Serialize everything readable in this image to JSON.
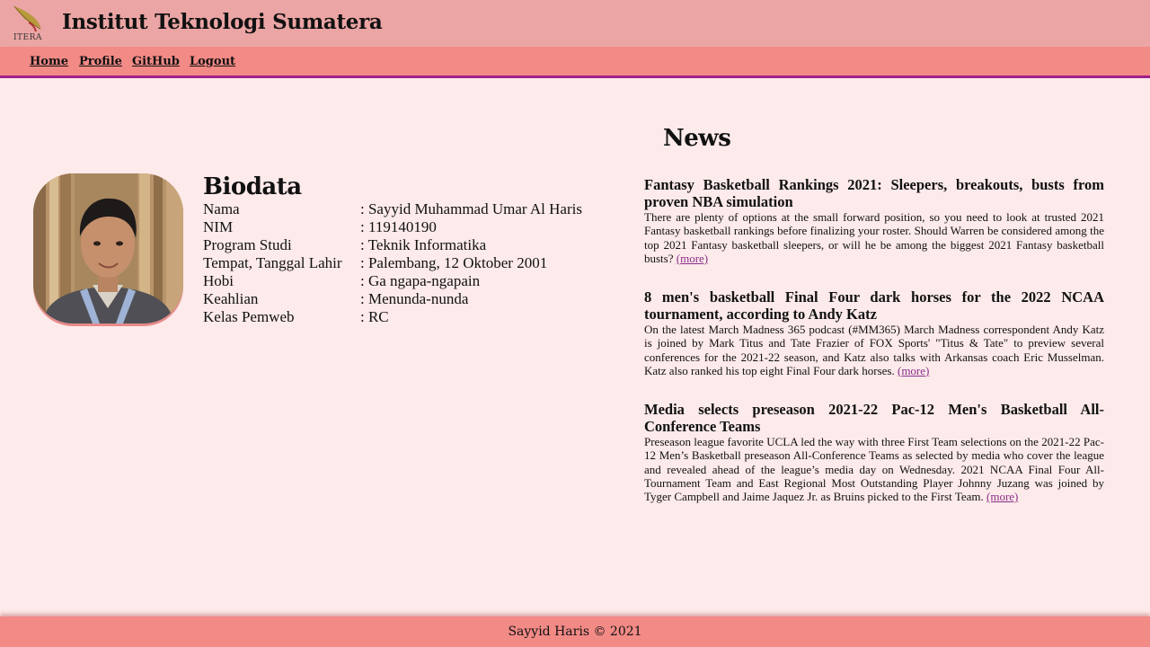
{
  "header": {
    "title": "Institut Teknologi Sumatera",
    "logo_text": "ITERA"
  },
  "nav": {
    "items": [
      {
        "label": "Home"
      },
      {
        "label": "Profile"
      },
      {
        "label": "GitHub"
      },
      {
        "label": "Logout"
      }
    ]
  },
  "biodata": {
    "title": "Biodata",
    "rows": [
      {
        "label": "Nama",
        "value": ": Sayyid Muhammad Umar Al Haris"
      },
      {
        "label": "NIM",
        "value": ": 119140190"
      },
      {
        "label": "Program Studi",
        "value": ": Teknik Informatika"
      },
      {
        "label": "Tempat, Tanggal Lahir",
        "value": ": Palembang, 12 Oktober 2001"
      },
      {
        "label": "Hobi",
        "value": ": Ga ngapa-ngapain"
      },
      {
        "label": "Keahlian",
        "value": ": Menunda-nunda"
      },
      {
        "label": "Kelas Pemweb",
        "value": ": RC"
      }
    ]
  },
  "news": {
    "title": "News",
    "more_label": "(more)",
    "items": [
      {
        "headline": "Fantasy Basketball Rankings 2021: Sleepers, breakouts, busts from proven NBA simulation",
        "body": "There are plenty of options at the small forward position, so you need to look at trusted 2021 Fantasy basketball rankings before finalizing your roster. Should Warren be considered among the top 2021 Fantasy basketball sleepers, or will he be among the biggest 2021 Fantasy basketball busts?"
      },
      {
        "headline": "8 men's basketball Final Four dark horses for the 2022 NCAA tournament, according to Andy Katz",
        "body": "On the latest March Madness 365 podcast (#MM365) March Madness correspondent Andy Katz is joined by Mark Titus and Tate Frazier of FOX Sports' \"Titus & Tate\" to preview several conferences for the 2021-22 season, and Katz also talks with Arkansas coach Eric Musselman. Katz also ranked his top eight Final Four dark horses."
      },
      {
        "headline": "Media selects preseason 2021-22 Pac-12 Men's Basketball All-Conference Teams",
        "body": "Preseason league favorite UCLA led the way with three First Team selections on the 2021-22 Pac-12 Men’s Basketball preseason All-Conference Teams as selected by media who cover the league and revealed ahead of the league’s media day on Wednesday. 2021 NCAA Final Four All-Tournament Team and East Regional Most Outstanding Player Johnny Juzang was joined by Tyger Campbell and Jaime Jaquez Jr. as Bruins picked to the First Team."
      }
    ]
  },
  "footer": {
    "text": "Sayyid Haris © 2021"
  },
  "colors": {
    "background": "#fdeaea",
    "topbar": "#eba5a4",
    "navbar": "#f28a86",
    "nav_underline": "#a0208c",
    "link": "#8a2f8a"
  }
}
